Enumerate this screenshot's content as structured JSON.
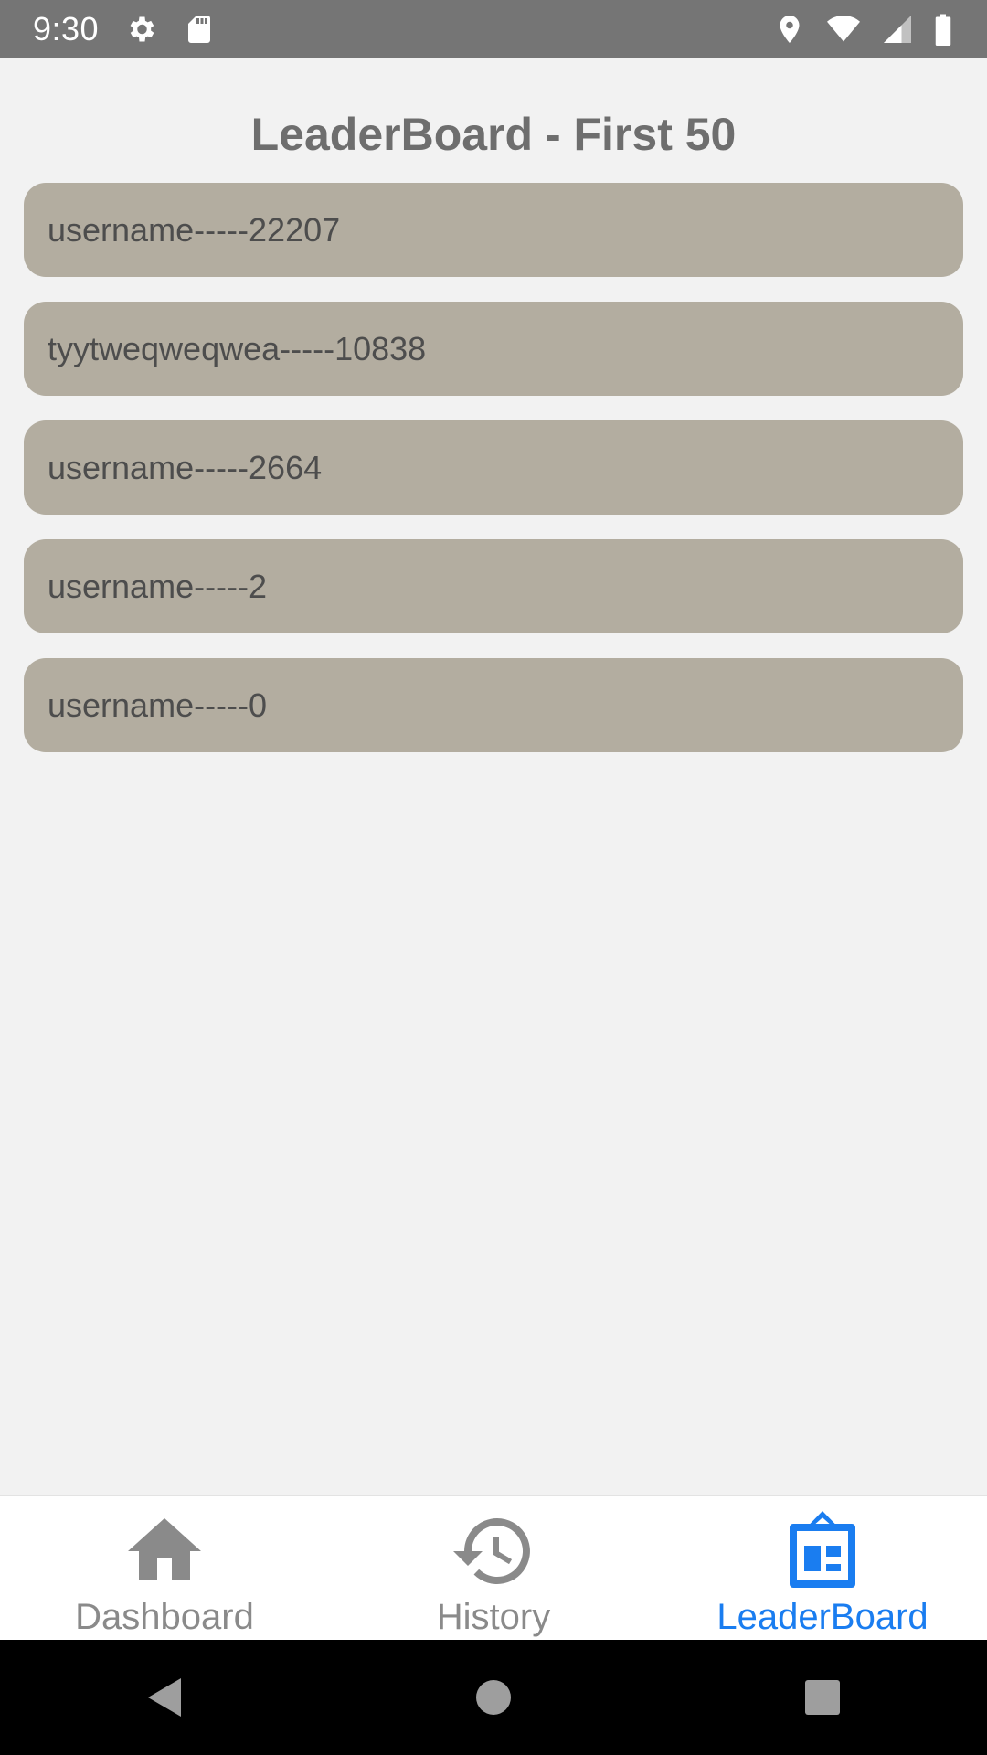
{
  "status_bar": {
    "time": "9:30",
    "left_icons": [
      "settings-gear-icon",
      "sd-card-icon"
    ],
    "right_icons": [
      "location-icon",
      "wifi-icon",
      "signal-icon",
      "battery-icon"
    ]
  },
  "page": {
    "title": "LeaderBoard - First 50"
  },
  "leaderboard": {
    "items": [
      {
        "text": "username-----22207"
      },
      {
        "text": "tyytweqweqwea-----10838"
      },
      {
        "text": "username-----2664"
      },
      {
        "text": "username-----2"
      },
      {
        "text": "username-----0"
      }
    ]
  },
  "bottom_nav": {
    "items": [
      {
        "label": "Dashboard",
        "icon": "home-icon",
        "active": false
      },
      {
        "label": "History",
        "icon": "history-icon",
        "active": false
      },
      {
        "label": "LeaderBoard",
        "icon": "leaderboard-icon",
        "active": true
      }
    ]
  },
  "system_nav": {
    "buttons": [
      "back-icon",
      "home-circle-icon",
      "recents-icon"
    ]
  },
  "colors": {
    "status_bar": "#757575",
    "background": "#f2f2f2",
    "list_item": "#b3ada0",
    "accent": "#1a7df0",
    "inactive": "#8a8a8a"
  }
}
